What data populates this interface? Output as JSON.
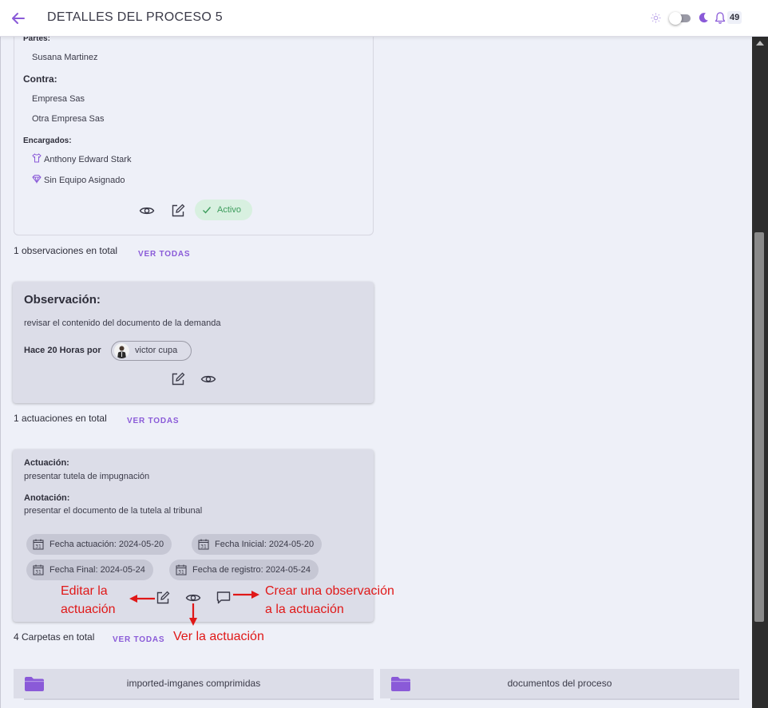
{
  "header": {
    "title": "DETALLES DEL PROCESO 5",
    "notification_count": "49",
    "accent_color": "#8a5ad8"
  },
  "process_card": {
    "parties_label": "Partes:",
    "parties": [
      "Susana Martinez"
    ],
    "against_label": "Contra:",
    "against": [
      "Empresa Sas",
      "Otra Empresa Sas"
    ],
    "assigned_label": "Encargados:",
    "assigned": [
      "Anthony Edward Stark",
      "Sin Equipo Asignado"
    ],
    "status": "Activo",
    "status_color": "#3d9c5c"
  },
  "observations_summary": {
    "count_text": "1 observaciones en total",
    "link": "VER TODAS"
  },
  "observation_card": {
    "title": "Observación:",
    "body": "revisar el contenido del documento de la demanda",
    "time_by": "Hace 20 Horas por",
    "user": "victor cupa"
  },
  "actuations_summary": {
    "count_text": "1 actuaciones en total",
    "link": "VER TODAS"
  },
  "actuation_card": {
    "actuation_label": "Actuación:",
    "actuation_text": "presentar tutela de impugnación",
    "annotation_label": "Anotación:",
    "annotation_text": "presentar el documento de la tutela al tribunal",
    "dates": [
      "Fecha actuación: 2024-05-20",
      "Fecha Inicial: 2024-05-20",
      "Fecha Final: 2024-05-24",
      "Fecha de registro: 2024-05-24"
    ]
  },
  "annotations": {
    "edit": [
      "Editar la",
      "actuación"
    ],
    "create_obs": [
      "Crear una observación",
      "a la actuación"
    ],
    "view": "Ver la actuación",
    "color": "#e01818"
  },
  "folders_summary": {
    "count_text": "4 Carpetas en total",
    "link": "VER TODAS"
  },
  "folders": [
    "imported-imganes comprimidas",
    "documentos del proceso"
  ]
}
